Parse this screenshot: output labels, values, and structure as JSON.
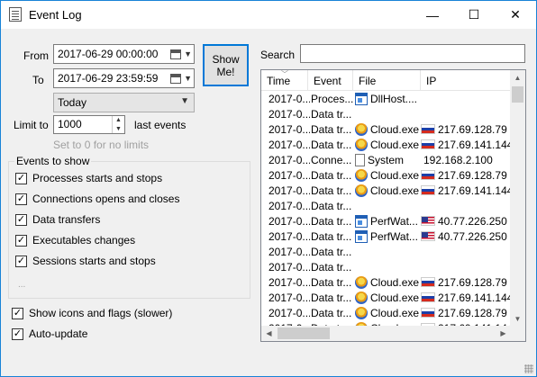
{
  "window": {
    "title": "Event Log",
    "controls": {
      "minimize": "—",
      "maximize": "☐",
      "close": "✕"
    }
  },
  "filter": {
    "from_label": "From",
    "from_value": "2017-06-29 00:00:00",
    "to_label": "To",
    "to_value": "2017-06-29 23:59:59",
    "range_value": "Today",
    "show_button": "Show Me!",
    "limit_label": "Limit to",
    "limit_value": "1000",
    "limit_suffix": "last events",
    "limit_hint": "Set to 0 for no limits"
  },
  "events_group": {
    "title": "Events to show",
    "items": [
      {
        "label": "Processes starts and stops",
        "checked": true
      },
      {
        "label": "Connections opens and closes",
        "checked": true
      },
      {
        "label": "Data transfers",
        "checked": true
      },
      {
        "label": "Executables changes",
        "checked": true
      },
      {
        "label": "Sessions starts and stops",
        "checked": true
      }
    ],
    "more": "..."
  },
  "options": {
    "show_icons": {
      "label": "Show icons and flags (slower)",
      "checked": true
    },
    "auto_update": {
      "label": "Auto-update",
      "checked": true
    }
  },
  "search": {
    "label": "Search",
    "value": ""
  },
  "table": {
    "columns": [
      "Time",
      "Event",
      "File",
      "IP"
    ],
    "rows": [
      {
        "time": "2017-0...",
        "event": "Proces...",
        "file": "DllHost....",
        "file_icon": "window-app-icon",
        "ip": "",
        "flag": ""
      },
      {
        "time": "2017-0...",
        "event": "Data tr...",
        "file": "",
        "file_icon": "",
        "ip": "",
        "flag": ""
      },
      {
        "time": "2017-0...",
        "event": "Data tr...",
        "file": "Cloud.exe",
        "file_icon": "cloud-app-icon",
        "ip": "217.69.128.79",
        "flag": "ru"
      },
      {
        "time": "2017-0...",
        "event": "Data tr...",
        "file": "Cloud.exe",
        "file_icon": "cloud-app-icon",
        "ip": "217.69.141.144",
        "flag": "ru"
      },
      {
        "time": "2017-0...",
        "event": "Conne...",
        "file": "System",
        "file_icon": "system-file-icon",
        "ip": "192.168.2.100",
        "flag": ""
      },
      {
        "time": "2017-0...",
        "event": "Data tr...",
        "file": "Cloud.exe",
        "file_icon": "cloud-app-icon",
        "ip": "217.69.128.79",
        "flag": "ru"
      },
      {
        "time": "2017-0...",
        "event": "Data tr...",
        "file": "Cloud.exe",
        "file_icon": "cloud-app-icon",
        "ip": "217.69.141.144",
        "flag": "ru"
      },
      {
        "time": "2017-0...",
        "event": "Data tr...",
        "file": "",
        "file_icon": "",
        "ip": "",
        "flag": ""
      },
      {
        "time": "2017-0...",
        "event": "Data tr...",
        "file": "PerfWat...",
        "file_icon": "window-app-icon",
        "ip": "40.77.226.250",
        "flag": "us"
      },
      {
        "time": "2017-0...",
        "event": "Data tr...",
        "file": "PerfWat...",
        "file_icon": "window-app-icon",
        "ip": "40.77.226.250",
        "flag": "us"
      },
      {
        "time": "2017-0...",
        "event": "Data tr...",
        "file": "",
        "file_icon": "",
        "ip": "",
        "flag": ""
      },
      {
        "time": "2017-0...",
        "event": "Data tr...",
        "file": "",
        "file_icon": "",
        "ip": "",
        "flag": ""
      },
      {
        "time": "2017-0...",
        "event": "Data tr...",
        "file": "Cloud.exe",
        "file_icon": "cloud-app-icon",
        "ip": "217.69.128.79",
        "flag": "ru"
      },
      {
        "time": "2017-0...",
        "event": "Data tr...",
        "file": "Cloud.exe",
        "file_icon": "cloud-app-icon",
        "ip": "217.69.141.144",
        "flag": "ru"
      },
      {
        "time": "2017-0...",
        "event": "Data tr...",
        "file": "Cloud.exe",
        "file_icon": "cloud-app-icon",
        "ip": "217.69.128.79",
        "flag": "ru"
      },
      {
        "time": "2017-0...",
        "event": "Data tr...",
        "file": "Cloud.exe",
        "file_icon": "cloud-app-icon",
        "ip": "217.69.141.144",
        "flag": "ru"
      },
      {
        "time": "2017-0...",
        "event": "Data tr...",
        "file": "",
        "file_icon": "",
        "ip": "",
        "flag": ""
      }
    ]
  }
}
